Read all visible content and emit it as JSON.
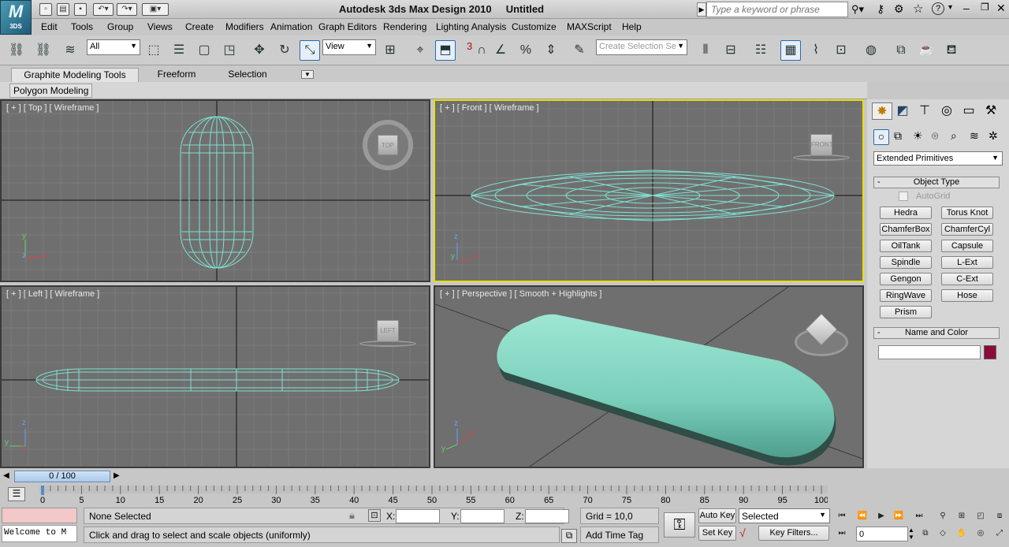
{
  "app": {
    "logo_text": "3DS",
    "title": "Autodesk 3ds Max Design 2010",
    "document": "Untitled",
    "search_placeholder": "Type a keyword or phrase"
  },
  "menu": [
    "Edit",
    "Tools",
    "Group",
    "Views",
    "Create",
    "Modifiers",
    "Animation",
    "Graph Editors",
    "Rendering",
    "Lighting Analysis",
    "Customize",
    "MAXScript",
    "Help"
  ],
  "toolbar": {
    "selection_filter": "All",
    "reference_coord": "View",
    "snap_count": "3",
    "named_selection_placeholder": "Create Selection Se"
  },
  "ribbon": {
    "tabs": [
      "Graphite Modeling Tools",
      "Freeform",
      "Selection"
    ],
    "subtab": "Polygon Modeling"
  },
  "viewports": {
    "top": {
      "label": "[ + ] [ Top ] [ Wireframe ]",
      "cube": "TOP",
      "axis_a": "y",
      "axis_b": "x",
      "axis_c": "z"
    },
    "front": {
      "label": "[ + ] [ Front ] [ Wireframe ]",
      "cube": "FRONT",
      "axis_a": "z",
      "axis_b": "x",
      "axis_c": "y"
    },
    "left": {
      "label": "[ + ] [ Left ] [ Wireframe ]",
      "cube": "LEFT",
      "axis_a": "z",
      "axis_b": "y",
      "axis_c": "x"
    },
    "perspective": {
      "label": "[ + ] [ Perspective ] [ Smooth + Highlights ]",
      "axis_a": "z",
      "axis_b": "x",
      "axis_c": "y"
    }
  },
  "command_panel": {
    "category": "Extended Primitives",
    "object_type_title": "Object Type",
    "autogrid": "AutoGrid",
    "buttons": [
      [
        "Hedra",
        "Torus Knot"
      ],
      [
        "ChamferBox",
        "ChamferCyl"
      ],
      [
        "OilTank",
        "Capsule"
      ],
      [
        "Spindle",
        "L-Ext"
      ],
      [
        "Gengon",
        "C-Ext"
      ],
      [
        "RingWave",
        "Hose"
      ],
      [
        "Prism",
        ""
      ]
    ],
    "name_color_title": "Name and Color",
    "object_color": "#8c0a3c"
  },
  "timeline": {
    "slider": "0 / 100",
    "ticks": [
      "0",
      "5",
      "10",
      "15",
      "20",
      "25",
      "30",
      "35",
      "40",
      "45",
      "50",
      "55",
      "60",
      "65",
      "70",
      "75",
      "80",
      "85",
      "90",
      "95",
      "100"
    ]
  },
  "status": {
    "maxscript": "Welcome to M",
    "selection": "None Selected",
    "prompt": "Click and drag to select and scale objects (uniformly)",
    "x_label": "X:",
    "y_label": "Y:",
    "z_label": "Z:",
    "grid": "Grid = 10,0",
    "add_time_tag": "Add Time Tag",
    "auto_key": "Auto Key",
    "set_key": "Set Key",
    "key_mode": "Selected",
    "key_filters": "Key Filters...",
    "frame": "0"
  },
  "colors": {
    "wire": "#7fe0d2",
    "viewport_bg": "#6f6f6f",
    "active_border": "#e8e010",
    "capsule": "#86d8c4"
  }
}
